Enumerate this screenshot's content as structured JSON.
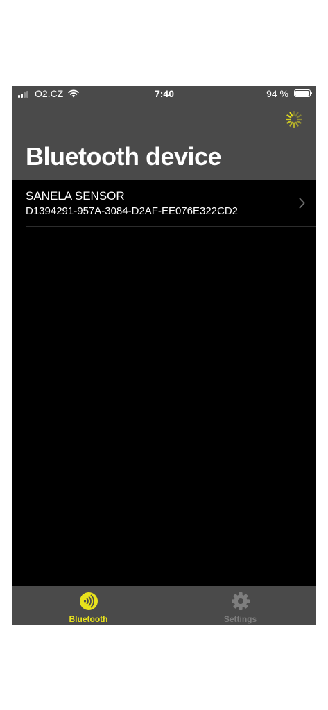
{
  "status_bar": {
    "carrier": "O2.CZ",
    "time": "7:40",
    "battery_percent": "94 %",
    "battery_level": 0.94,
    "signal_bars": 2
  },
  "header": {
    "title": "Bluetooth device",
    "activity_indicator_icon": "spinner-icon"
  },
  "devices": [
    {
      "name": "SANELA SENSOR",
      "id": "D1394291-957A-3084-D2AF-EE076E322CD2"
    }
  ],
  "tab_bar": {
    "tabs": [
      {
        "label": "Bluetooth",
        "icon": "bluetooth-signal-icon",
        "active": true
      },
      {
        "label": "Settings",
        "icon": "gear-icon",
        "active": false
      }
    ]
  },
  "colors": {
    "accent": "#e8e21c",
    "header_bg": "#4a4a4a",
    "background": "#000000",
    "inactive_tab": "#7e7e7e"
  }
}
